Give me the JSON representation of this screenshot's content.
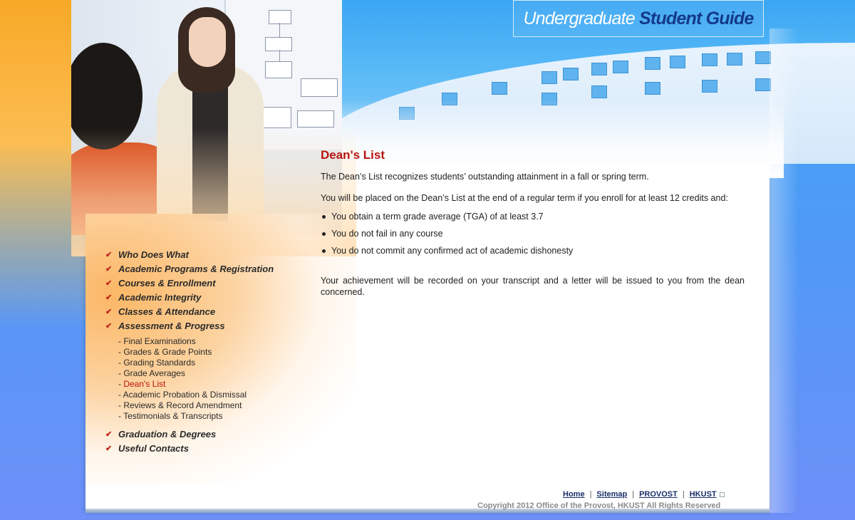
{
  "header": {
    "title_part_a": "Undergraduate",
    "title_part_b": "Student Guide"
  },
  "nav": {
    "items_top": [
      {
        "label": "Who Does What"
      },
      {
        "label": "Academic Programs & Registration"
      },
      {
        "label": "Courses & Enrollment"
      },
      {
        "label": "Academic Integrity"
      },
      {
        "label": "Classes & Attendance"
      },
      {
        "label": "Assessment & Progress"
      }
    ],
    "sub_items": [
      {
        "label": "Final Examinations",
        "active": false
      },
      {
        "label": "Grades & Grade Points",
        "active": false
      },
      {
        "label": "Grading Standards",
        "active": false
      },
      {
        "label": "Grade Averages",
        "active": false
      },
      {
        "label": "Dean's List",
        "active": true
      },
      {
        "label": "Academic Probation & Dismissal",
        "active": false
      },
      {
        "label": "Reviews & Record Amendment",
        "active": false
      },
      {
        "label": "Testimonials & Transcripts",
        "active": false
      }
    ],
    "items_bottom": [
      {
        "label": "Graduation & Degrees"
      },
      {
        "label": "Useful Contacts"
      }
    ],
    "check_icon": "✔",
    "sub_prefix": "- "
  },
  "content": {
    "title": "Dean's List",
    "intro": "The Dean’s List recognizes students’ outstanding attainment in a fall or spring term.",
    "condition": "You will be placed on the Dean’s List at the end of a regular term if you enroll for at least 12 credits and:",
    "criteria": [
      "You obtain a term grade average (TGA) of at least 3.7",
      "You do not fail in any course",
      "You do not commit any confirmed act of academic dishonesty"
    ],
    "closing": "Your achievement will be recorded on your transcript and a letter will be issued to you from the dean concerned."
  },
  "footer": {
    "links": [
      "Home",
      "Sitemap",
      "PROVOST",
      "HKUST"
    ],
    "separator": "|",
    "copyright": "Copyright 2012 Office of the Provost, HKUST   All Rights Reserved"
  },
  "colors": {
    "accent_red": "#b8140f",
    "title_blue": "#143a8a",
    "link_navy": "#1a2f6a"
  }
}
